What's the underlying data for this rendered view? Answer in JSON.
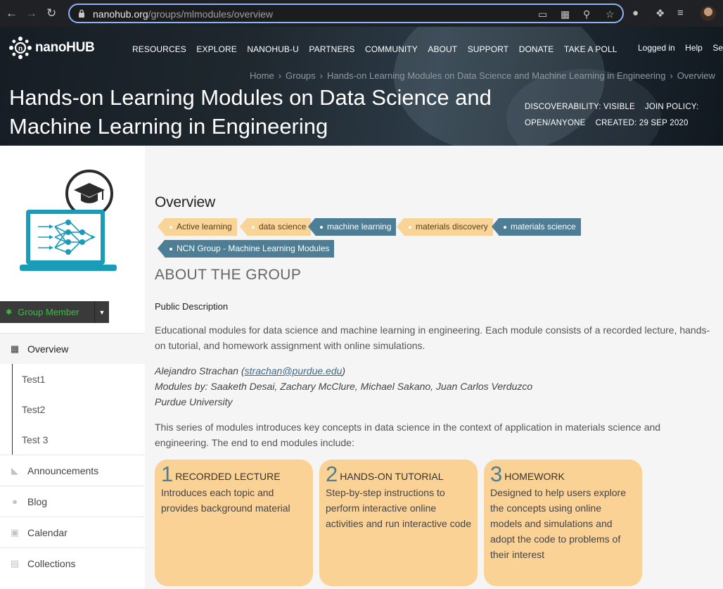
{
  "browser": {
    "url_host": "nanohub.org",
    "url_path": "/groups/mlmodules/overview"
  },
  "site": {
    "logo_text": "nanoHUB",
    "nav": [
      "RESOURCES",
      "EXPLORE",
      "NANOHUB-U",
      "PARTNERS",
      "COMMUNITY",
      "ABOUT",
      "SUPPORT",
      "DONATE",
      "TAKE A POLL"
    ],
    "user_nav": [
      "Logged in",
      "Help",
      "Search"
    ]
  },
  "breadcrumb": [
    "Home",
    "Groups",
    "Hands-on Learning Modules on Data Science and Machine Learning in Engineering",
    "Overview"
  ],
  "group": {
    "title": "Hands-on Learning Modules on Data Science and Machine Learning in Engineering",
    "discoverability": "DISCOVERABILITY: VISIBLE",
    "join_policy": "JOIN POLICY:",
    "join_value": "OPEN/ANYONE",
    "created": "CREATED: 29 SEP 2020"
  },
  "sidebar": {
    "member_button": "Group Member",
    "nav": [
      {
        "label": "Overview",
        "icon": "grid-icon"
      },
      {
        "label": "Announcements",
        "icon": "megaphone-icon"
      },
      {
        "label": "Blog",
        "icon": "speech-bubble-icon"
      },
      {
        "label": "Calendar",
        "icon": "calendar-icon"
      },
      {
        "label": "Collections",
        "icon": "collections-icon"
      }
    ],
    "subnav": [
      "Test1",
      "Test2",
      "Test 3"
    ]
  },
  "main": {
    "heading": "Overview",
    "tags": [
      "Active learning",
      "data science",
      "machine learning",
      "materials discovery",
      "materials science",
      "NCN Group - Machine Learning Modules"
    ],
    "about_heading": "ABOUT THE GROUP",
    "public_description_label": "Public Description",
    "description_line1": "Educational modules for data science and machine learning in engineering. Each module consists of a recorded lecture, hands-",
    "description_line2": "on tutorial, and homework assignment with online simulations.",
    "author_name": "Alejandro Strachan (",
    "author_email": "strachan@purdue.edu",
    "author_close": ")",
    "modules_by": "Modules by: Saaketh Desai, Zachary McClure, Michael Sakano, Juan Carlos Verduzco",
    "university": "Purdue University",
    "series_line1": "This series of modules introduces key concepts in data science in the context of application in materials science and",
    "series_line2": "engineering. The end to end modules include:",
    "cards": [
      {
        "num": "1",
        "title": "RECORDED LECTURE",
        "desc": "Introduces each topic and provides background material"
      },
      {
        "num": "2",
        "title": "HANDS-ON TUTORIAL",
        "desc": "Step-by-step instructions to perform interactive online activities and run interactive code"
      },
      {
        "num": "3",
        "title": "HOMEWORK",
        "desc": "Designed to help users explore the concepts using online models and simulations and adopt the code to problems of their interest"
      }
    ]
  },
  "colors": {
    "tag_yellow": "#f8d498",
    "tag_blue": "#4e7e95",
    "card_bg": "#fbd296",
    "member_green": "#35c13c"
  }
}
